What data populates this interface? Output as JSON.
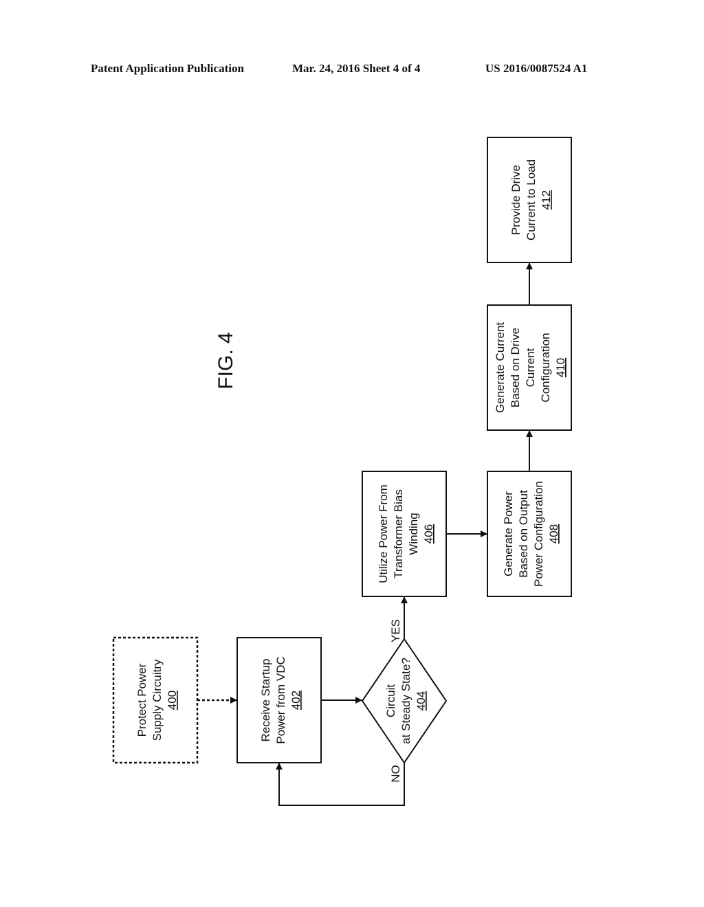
{
  "header": {
    "publication": "Patent Application Publication",
    "date_sheet": "Mar. 24, 2016  Sheet 4 of 4",
    "number": "US 2016/0087524 A1"
  },
  "figure": {
    "label": "FIG. 4"
  },
  "nodes": {
    "n400": {
      "lines": [
        "Protect Power",
        "Supply Circuitry"
      ],
      "ref": "400",
      "style": "dashed"
    },
    "n402": {
      "lines": [
        "Receive Startup",
        "Power from VDC"
      ],
      "ref": "402"
    },
    "n404": {
      "lines": [
        "Circuit",
        "at Steady State?"
      ],
      "ref": "404",
      "shape": "decision"
    },
    "n406": {
      "lines": [
        "Utilize Power From",
        "Transformer Bias",
        "Winding"
      ],
      "ref": "406"
    },
    "n408": {
      "lines": [
        "Generate Power",
        "Based on Output",
        "Power Configuration"
      ],
      "ref": "408"
    },
    "n410": {
      "lines": [
        "Generate Current",
        "Based on Drive",
        "Current",
        "Configuration"
      ],
      "ref": "410"
    },
    "n412": {
      "lines": [
        "Provide Drive",
        "Current to Load"
      ],
      "ref": "412"
    }
  },
  "edges": {
    "yes_label": "YES",
    "no_label": "NO"
  }
}
